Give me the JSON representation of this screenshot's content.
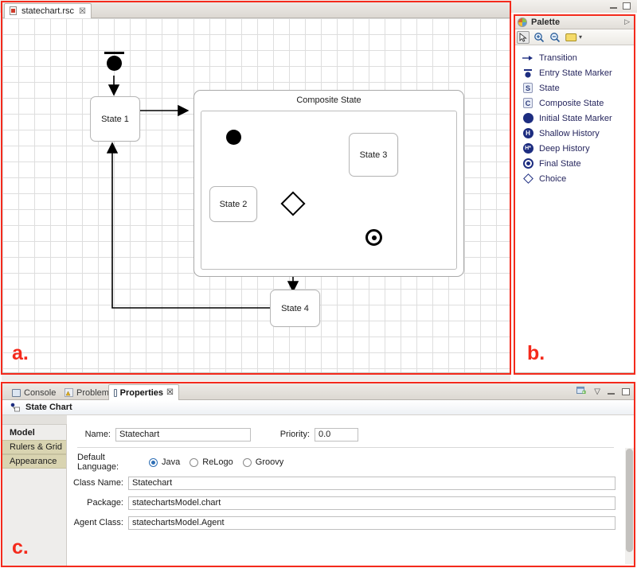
{
  "window": {
    "minimize_label": "Minimize",
    "maximize_label": "Maximize"
  },
  "editor": {
    "tab": {
      "title": "statechart.rsc",
      "close_glyph": "☒",
      "icon": "rsc-file-icon"
    },
    "annotation": "a.",
    "diagram": {
      "composite_state_label": "Composite State",
      "nodes": [
        {
          "id": "state1",
          "label": "State 1"
        },
        {
          "id": "state2",
          "label": "State 2"
        },
        {
          "id": "state3",
          "label": "State 3"
        },
        {
          "id": "state4",
          "label": "State 4"
        }
      ],
      "markers": [
        {
          "id": "entry-state-marker",
          "label": "Entry State Marker"
        },
        {
          "id": "initial-state-marker",
          "label": "Initial State Marker"
        },
        {
          "id": "final-state",
          "label": "Final State"
        },
        {
          "id": "choice",
          "label": "Choice"
        }
      ]
    }
  },
  "palette": {
    "title": "Palette",
    "annotation": "b.",
    "expand_glyph": "▷",
    "tools": [
      {
        "name": "select-tool",
        "glyph": "↖",
        "selected": true
      },
      {
        "name": "zoom-in-tool",
        "glyph": "+"
      },
      {
        "name": "zoom-out-tool",
        "glyph": "−"
      },
      {
        "name": "layout-tool",
        "glyph": ""
      },
      {
        "name": "layout-dropdown",
        "glyph": "▾"
      }
    ],
    "items": [
      {
        "label": "Transition",
        "icon": "arrow-icon",
        "badge": ""
      },
      {
        "label": "Entry State Marker",
        "icon": "entry-state-icon",
        "badge": ""
      },
      {
        "label": "State",
        "icon": "state-badge-icon",
        "badge": "S"
      },
      {
        "label": "Composite State",
        "icon": "composite-state-badge-icon",
        "badge": "C"
      },
      {
        "label": "Initial State Marker",
        "icon": "filled-circle-icon",
        "badge": ""
      },
      {
        "label": "Shallow History",
        "icon": "history-circle-icon",
        "badge": "H"
      },
      {
        "label": "Deep History",
        "icon": "deep-history-circle-icon",
        "badge": "H*"
      },
      {
        "label": "Final State",
        "icon": "final-state-icon",
        "badge": ""
      },
      {
        "label": "Choice",
        "icon": "diamond-icon",
        "badge": ""
      }
    ]
  },
  "properties": {
    "annotation": "c.",
    "tabs": [
      {
        "label": "Console",
        "icon": "console-icon",
        "active": false,
        "close": ""
      },
      {
        "label": "Problems",
        "icon": "problems-icon",
        "active": false,
        "close": ""
      },
      {
        "label": "Properties",
        "icon": "properties-icon",
        "active": true,
        "close": "☒"
      }
    ],
    "toolbar_icons": [
      {
        "name": "new-view-icon",
        "glyph": ""
      },
      {
        "name": "view-menu-icon",
        "glyph": "▽"
      },
      {
        "name": "minimize-icon",
        "glyph": ""
      },
      {
        "name": "maximize-icon",
        "glyph": ""
      }
    ],
    "header": {
      "title": "State Chart",
      "icon": "state-chart-icon"
    },
    "side_tabs": [
      {
        "label": "Model",
        "selected": true
      },
      {
        "label": "Rulers & Grid",
        "selected": false
      },
      {
        "label": "Appearance",
        "selected": false
      }
    ],
    "form": {
      "name_label": "Name:",
      "name_value": "Statechart",
      "priority_label": "Priority:",
      "priority_value": "0.0",
      "default_language_label": "Default Language:",
      "language_options": [
        {
          "label": "Java",
          "selected": true
        },
        {
          "label": "ReLogo",
          "selected": false
        },
        {
          "label": "Groovy",
          "selected": false
        }
      ],
      "class_name_label": "Class Name:",
      "class_name_value": "Statechart",
      "package_label": "Package:",
      "package_value": "statechartsModel.chart",
      "agent_class_label": "Agent Class:",
      "agent_class_value": "statechartsModel.Agent"
    }
  },
  "colors": {
    "annotation_red": "#f42a1c",
    "palette_text": "#26265e",
    "side_tab_unselected": "#d9d4b1",
    "accent_blue": "#2f6fb5"
  }
}
